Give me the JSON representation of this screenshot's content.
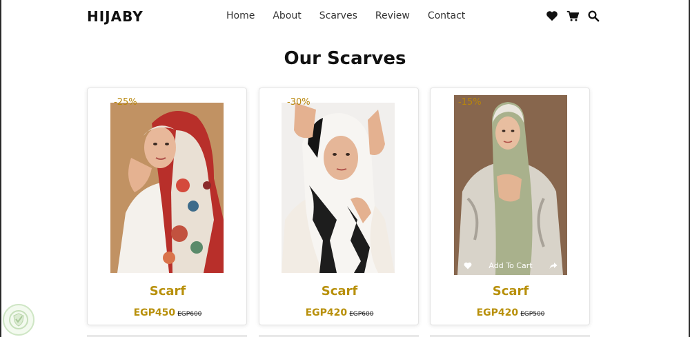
{
  "header": {
    "logo": "HIJABY",
    "nav": [
      "Home",
      "About",
      "Scarves",
      "Review",
      "Contact"
    ],
    "icons": [
      "heart-icon",
      "cart-icon",
      "search-icon"
    ]
  },
  "section_title": "Our Scarves",
  "products": [
    {
      "discount": "-25%",
      "name": "Scarf",
      "price": "EGP450",
      "old_price": "EGP600"
    },
    {
      "discount": "-30%",
      "name": "Scarf",
      "price": "EGP420",
      "old_price": "EGP600"
    },
    {
      "discount": "-15%",
      "name": "Scarf",
      "price": "EGP420",
      "old_price": "EGP500",
      "hover_actions": {
        "add_to_cart": "Add To Cart",
        "icons": [
          "heart-icon",
          "share-icon"
        ]
      }
    }
  ],
  "colors": {
    "accent": "#b8900b",
    "text": "#111111"
  }
}
